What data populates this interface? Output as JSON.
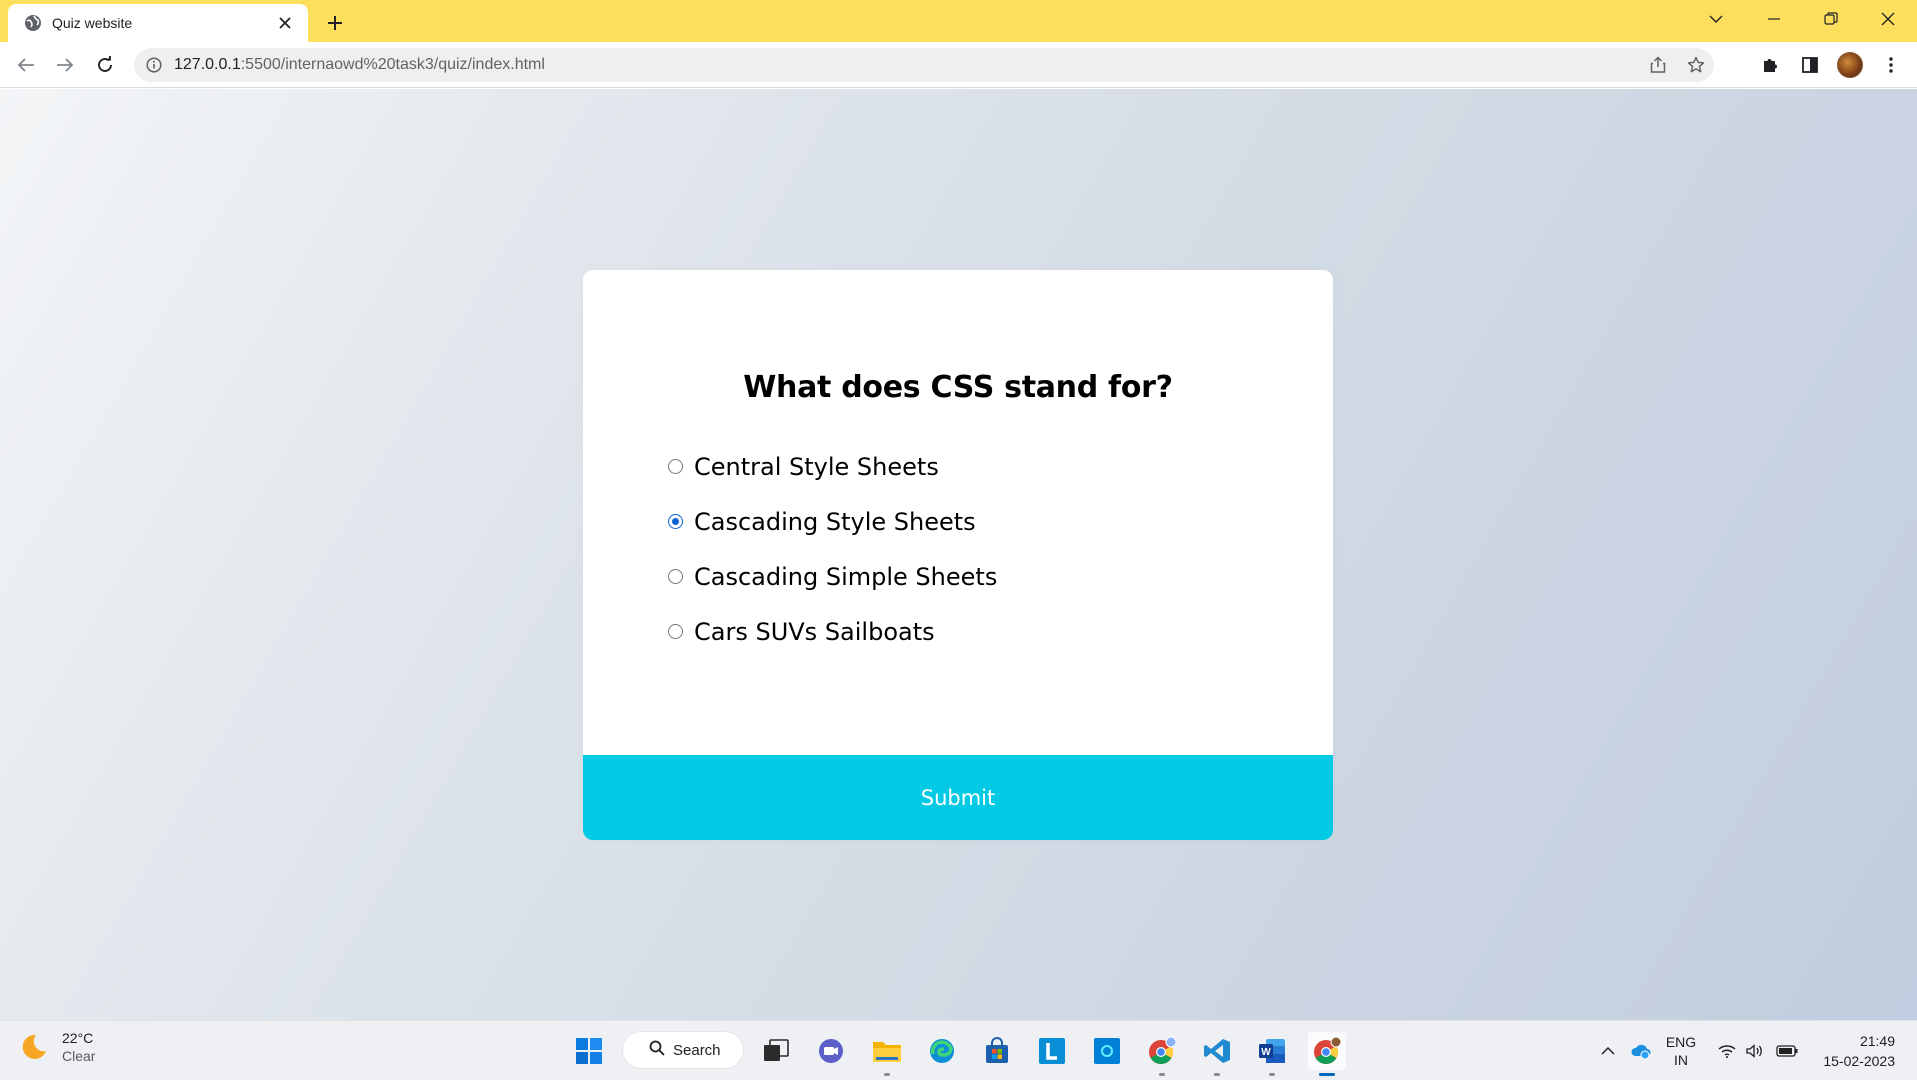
{
  "browser": {
    "tab": {
      "title": "Quiz website",
      "favicon": "globe-icon",
      "close_icon": "close-icon"
    },
    "new_tab_icon": "plus-icon",
    "window_controls": [
      "chevron-down-icon",
      "minimize-icon",
      "restore-icon",
      "close-icon"
    ],
    "toolbar": {
      "back_icon": "back-arrow-icon",
      "forward_icon": "forward-arrow-icon",
      "reload_icon": "reload-icon",
      "site_info_icon": "info-icon",
      "url_host": "127.0.0.1",
      "url_rest": ":5500/internaowd%20task3/quiz/index.html",
      "share_icon": "share-icon",
      "bookmark_icon": "star-icon",
      "extensions_icon": "puzzle-icon",
      "side_panel_icon": "side-panel-icon",
      "profile_icon": "avatar",
      "menu_icon": "kebab-menu-icon"
    }
  },
  "quiz": {
    "question": "What does CSS stand for?",
    "answers": [
      {
        "id": "a",
        "label": "Central Style Sheets",
        "checked": false
      },
      {
        "id": "b",
        "label": "Cascading Style Sheets",
        "checked": true
      },
      {
        "id": "c",
        "label": "Cascading Simple Sheets",
        "checked": false
      },
      {
        "id": "d",
        "label": "Cars SUVs Sailboats",
        "checked": false
      }
    ],
    "submit_label": "Submit",
    "colors": {
      "submit_bg": "#03cae4",
      "radio_checked": "#0b63d7",
      "card_bg": "#ffffff"
    }
  },
  "taskbar": {
    "weather": {
      "temp": "22°C",
      "condition": "Clear",
      "icon": "moon-icon"
    },
    "search_label": "Search",
    "apps": [
      {
        "name": "start-icon"
      },
      {
        "name": "task-view-icon"
      },
      {
        "name": "teams-chat-icon"
      },
      {
        "name": "file-explorer-icon"
      },
      {
        "name": "edge-icon"
      },
      {
        "name": "microsoft-store-icon"
      },
      {
        "name": "l-app-icon"
      },
      {
        "name": "blue-square-app-icon"
      },
      {
        "name": "chrome-profile-icon"
      },
      {
        "name": "vscode-icon"
      },
      {
        "name": "word-icon"
      },
      {
        "name": "chrome-icon"
      }
    ],
    "tray": {
      "chevron_icon": "chevron-up-icon",
      "lang_line1": "ENG",
      "lang_line2": "IN",
      "wifi_icon": "wifi-icon",
      "volume_icon": "volume-icon",
      "battery_icon": "battery-icon"
    },
    "clock": {
      "time": "21:49",
      "date": "15-02-2023"
    }
  }
}
